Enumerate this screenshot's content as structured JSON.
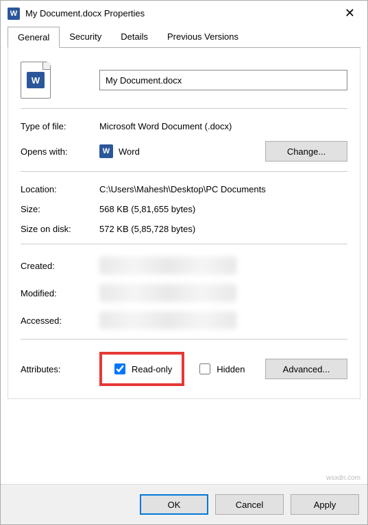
{
  "window": {
    "title": "My Document.docx Properties"
  },
  "tabs": {
    "general": "General",
    "security": "Security",
    "details": "Details",
    "previous": "Previous Versions"
  },
  "file": {
    "name": "My Document.docx",
    "type_label": "Type of file:",
    "type_value": "Microsoft Word Document (.docx)",
    "opens_label": "Opens with:",
    "opens_value": "Word",
    "change_btn": "Change...",
    "location_label": "Location:",
    "location_value": "C:\\Users\\Mahesh\\Desktop\\PC Documents",
    "size_label": "Size:",
    "size_value": "568 KB (5,81,655 bytes)",
    "sizedisk_label": "Size on disk:",
    "sizedisk_value": "572 KB (5,85,728 bytes)",
    "created_label": "Created:",
    "modified_label": "Modified:",
    "accessed_label": "Accessed:",
    "attributes_label": "Attributes:",
    "readonly_label": "Read-only",
    "hidden_label": "Hidden",
    "advanced_btn": "Advanced..."
  },
  "buttons": {
    "ok": "OK",
    "cancel": "Cancel",
    "apply": "Apply"
  },
  "watermark": "wsxdn.com"
}
